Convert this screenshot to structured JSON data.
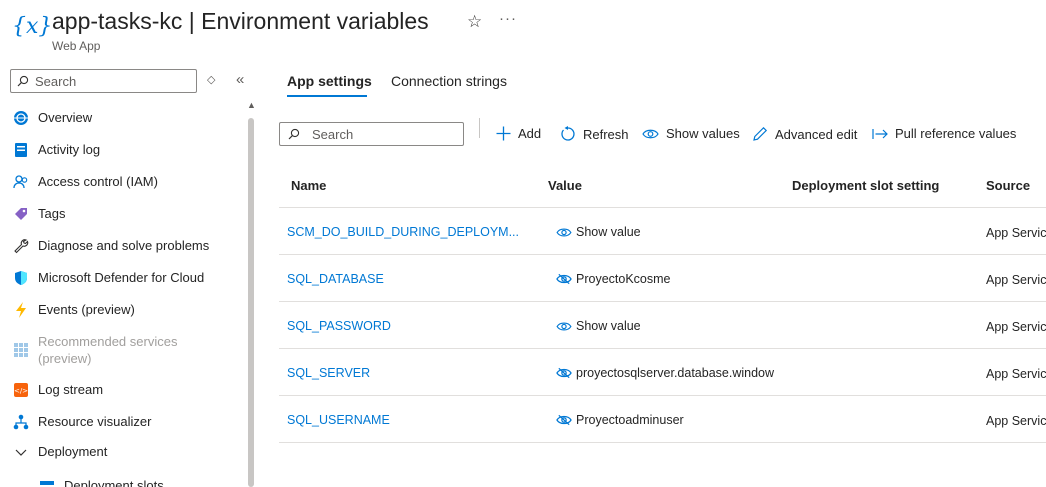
{
  "header": {
    "icon": "function-braces-icon",
    "title": "app-tasks-kc | Environment variables",
    "subtitle": "Web App"
  },
  "sidebar": {
    "search_placeholder": "Search",
    "items": [
      {
        "label": "Overview",
        "icon": "globe-icon"
      },
      {
        "label": "Activity log",
        "icon": "log-icon"
      },
      {
        "label": "Access control (IAM)",
        "icon": "people-icon"
      },
      {
        "label": "Tags",
        "icon": "tag-icon"
      },
      {
        "label": "Diagnose and solve problems",
        "icon": "wrench-icon"
      },
      {
        "label": "Microsoft Defender for Cloud",
        "icon": "shield-icon"
      },
      {
        "label": "Events (preview)",
        "icon": "lightning-icon"
      },
      {
        "label": "Recommended services (preview)",
        "icon": "grid-icon"
      },
      {
        "label": "Log stream",
        "icon": "log-stream-icon"
      },
      {
        "label": "Resource visualizer",
        "icon": "hierarchy-icon"
      },
      {
        "label": "Deployment",
        "icon": "chevron-down-icon"
      },
      {
        "label": "Deployment slots",
        "icon": "slots-icon"
      }
    ]
  },
  "tabs": [
    {
      "label": "App settings",
      "active": true
    },
    {
      "label": "Connection strings",
      "active": false
    }
  ],
  "toolbar": {
    "search_placeholder": "Search",
    "add": "Add",
    "refresh": "Refresh",
    "show_values": "Show values",
    "advanced_edit": "Advanced edit",
    "pull_reference": "Pull reference values"
  },
  "table": {
    "columns": [
      "Name",
      "Value",
      "Deployment slot setting",
      "Source"
    ],
    "rows": [
      {
        "name": "SCM_DO_BUILD_DURING_DEPLOYM...",
        "value": "Show value",
        "hidden": true,
        "slot": "",
        "source": "App Service"
      },
      {
        "name": "SQL_DATABASE",
        "value": "ProyectoKcosme",
        "hidden": false,
        "slot": "",
        "source": "App Service"
      },
      {
        "name": "SQL_PASSWORD",
        "value": "Show value",
        "hidden": true,
        "slot": "",
        "source": "App Service"
      },
      {
        "name": "SQL_SERVER",
        "value": "proyectosqlserver.database.window",
        "hidden": false,
        "slot": "",
        "source": "App Service"
      },
      {
        "name": "SQL_USERNAME",
        "value": "Proyectoadminuser",
        "hidden": false,
        "slot": "",
        "source": "App Service"
      }
    ]
  },
  "colors": {
    "accent": "#0078d4",
    "text": "#242424",
    "border": "#e1dfdd"
  }
}
